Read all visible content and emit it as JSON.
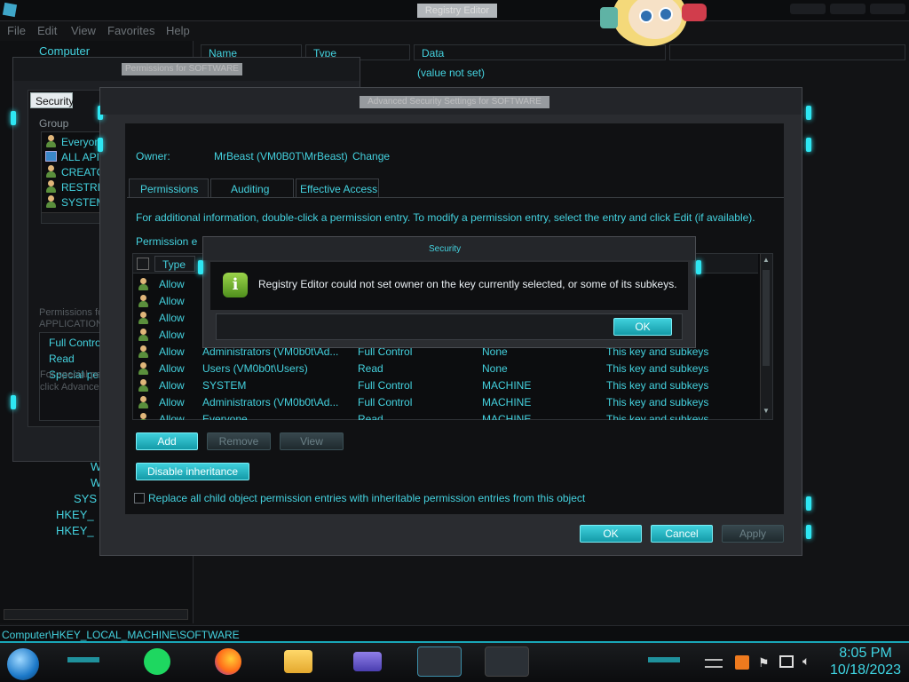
{
  "registry": {
    "title": "Registry Editor",
    "menu": [
      "File",
      "Edit",
      "View",
      "Favorites",
      "Help"
    ],
    "tree_root": "Computer",
    "columns": [
      "Name",
      "Type",
      "Data"
    ],
    "value_not_set": "(value not set)",
    "tree_items": [
      "W",
      "W",
      "SYS",
      "HKEY_",
      "HKEY_"
    ],
    "status_path": "Computer\\HKEY_LOCAL_MACHINE\\SOFTWARE"
  },
  "permissions_dialog": {
    "title": "Permissions for SOFTWARE",
    "tab": "Security",
    "group_label": "Group",
    "groups": [
      "Everyon",
      "ALL API",
      "CREATO",
      "RESTRIC",
      "SYSTEM"
    ],
    "perm_label": "Permissions for APPLICATION",
    "perms": [
      "Full Control",
      "Read",
      "Special perm"
    ],
    "special_note": "For special pe click Advance"
  },
  "advanced": {
    "title": "Advanced Security Settings for SOFTWARE",
    "owner_label": "Owner:",
    "owner_value": "MrBeast (VM0B0T\\MrBeast)",
    "change_link": "Change",
    "tabs": [
      "Permissions",
      "Auditing",
      "Effective Access"
    ],
    "info_text": "For additional information, double-click a permission entry. To modify a permission entry, select the entry and click Edit (if available).",
    "entries_label": "Permission e",
    "col_type": "Type",
    "rows": [
      {
        "type": "Allow",
        "principal": "",
        "access": "",
        "inherited": "",
        "applies": ""
      },
      {
        "type": "Allow",
        "principal": "",
        "access": "",
        "inherited": "",
        "applies": ""
      },
      {
        "type": "Allow",
        "principal": "",
        "access": "",
        "inherited": "",
        "applies": ""
      },
      {
        "type": "Allow",
        "principal": "",
        "access": "",
        "inherited": "",
        "applies": ""
      },
      {
        "type": "Allow",
        "principal": "Administrators (VM0b0t\\Ad...",
        "access": "Full Control",
        "inherited": "None",
        "applies": "This key and subkeys"
      },
      {
        "type": "Allow",
        "principal": "Users (VM0b0t\\Users)",
        "access": "Read",
        "inherited": "None",
        "applies": "This key and subkeys"
      },
      {
        "type": "Allow",
        "principal": "SYSTEM",
        "access": "Full Control",
        "inherited": "MACHINE",
        "applies": "This key and subkeys"
      },
      {
        "type": "Allow",
        "principal": "Administrators (VM0b0t\\Ad...",
        "access": "Full Control",
        "inherited": "MACHINE",
        "applies": "This key and subkeys"
      },
      {
        "type": "Allow",
        "principal": "Everyone",
        "access": "Read",
        "inherited": "MACHINE",
        "applies": "This key and subkeys"
      }
    ],
    "add": "Add",
    "remove": "Remove",
    "view": "View",
    "disable_inheritance": "Disable inheritance",
    "replace_checkbox": "Replace all child object permission entries with inheritable permission entries from this object",
    "ok": "OK",
    "cancel": "Cancel",
    "apply": "Apply"
  },
  "security_msg": {
    "title": "Security",
    "message": "Registry Editor could not set owner on the key currently selected, or some of its subkeys.",
    "ok": "OK"
  },
  "taskbar": {
    "time": "8:05 PM",
    "date": "10/18/2023"
  },
  "colors": {
    "accent": "#2ee6f2",
    "text_cyan": "#44d2df"
  }
}
